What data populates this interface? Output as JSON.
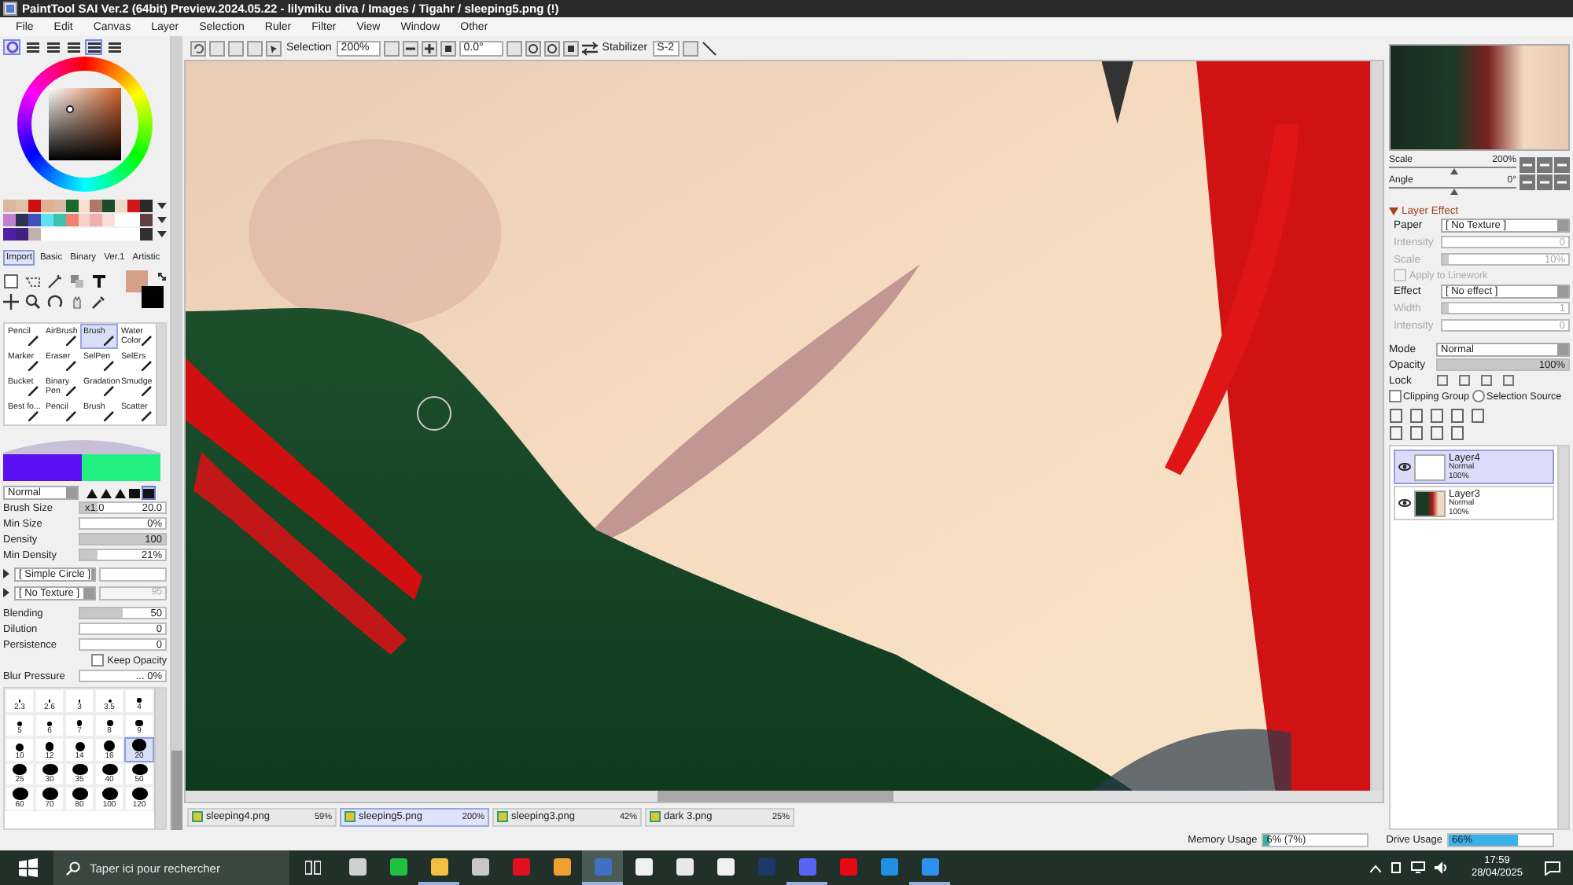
{
  "window": {
    "title": "PaintTool SAI Ver.2 (64bit) Preview.2024.05.22 - lilymiku diva / Images / Tigahr / sleeping5.png (!)"
  },
  "menu": [
    "File",
    "Edit",
    "Canvas",
    "Layer",
    "Selection",
    "Ruler",
    "Filter",
    "View",
    "Window",
    "Other"
  ],
  "panel_tabs": [
    {
      "selected": true
    },
    {
      "selected": false
    },
    {
      "selected": false
    },
    {
      "selected": false
    },
    {
      "selected": true
    },
    {
      "selected": false
    }
  ],
  "toolbar": {
    "selection_label": "Selection",
    "zoom": "200%",
    "angle": "0.0°",
    "stabilizer_label": "Stabilizer",
    "stabilizer": "S-2"
  },
  "swatches": [
    [
      {
        "color": "#d9b8a0"
      },
      {
        "color": "#e0c0a8"
      },
      {
        "color": "#cc1010"
      },
      {
        "color": "#e0b090"
      },
      {
        "color": "#d8b8a0"
      },
      {
        "color": "#1a6a30"
      },
      {
        "color": "#f5e0d0"
      },
      {
        "color": "#b07868"
      },
      {
        "color": "#1a4a28"
      },
      {
        "color": "#f0d8c8"
      },
      {
        "color": "#d01818"
      },
      {
        "color": "#2a2a2a"
      }
    ],
    [
      {
        "color": "#c080d0"
      },
      {
        "color": "#303050"
      },
      {
        "color": "#4050c0"
      },
      {
        "color": "#60e0f0"
      },
      {
        "color": "#40c0b0"
      },
      {
        "color": "#f08070"
      },
      {
        "color": "#f8d0c8"
      },
      {
        "color": "#f0b0b0"
      },
      {
        "color": "#f8e0d8"
      },
      {
        "color": "#ffffff"
      },
      {
        "color": "#ffffff"
      },
      {
        "color": "#604040"
      }
    ],
    [
      {
        "color": "#5020a0"
      },
      {
        "color": "#402080"
      },
      {
        "color": "#c0b0b0"
      },
      {
        "color": "#ffffff"
      },
      {
        "color": "#ffffff"
      },
      {
        "color": "#ffffff"
      },
      {
        "color": "#ffffff"
      },
      {
        "color": "#ffffff"
      },
      {
        "color": "#ffffff"
      },
      {
        "color": "#ffffff"
      },
      {
        "color": "#ffffff"
      },
      {
        "color": "#303030"
      }
    ]
  ],
  "tool_tabs": [
    {
      "label": "Import",
      "selected": true
    },
    {
      "label": "Basic",
      "selected": false
    },
    {
      "label": "Binary",
      "selected": false
    },
    {
      "label": "Ver.1",
      "selected": false
    },
    {
      "label": "Artistic",
      "selected": false
    }
  ],
  "brushes": [
    {
      "label": "Pencil",
      "selected": false
    },
    {
      "label": "AirBrush",
      "selected": false
    },
    {
      "label": "Brush",
      "selected": true
    },
    {
      "label": "Water Color",
      "selected": false
    },
    {
      "label": "Marker",
      "selected": false
    },
    {
      "label": "Eraser",
      "selected": false
    },
    {
      "label": "SelPen",
      "selected": false
    },
    {
      "label": "SelErs",
      "selected": false
    },
    {
      "label": "Bucket",
      "selected": false
    },
    {
      "label": "Binary Pen",
      "selected": false
    },
    {
      "label": "Gradation",
      "selected": false
    },
    {
      "label": "Smudge",
      "selected": false
    },
    {
      "label": "Best fo...",
      "selected": false
    },
    {
      "label": "Pencil",
      "selected": false
    },
    {
      "label": "Brush",
      "selected": false
    },
    {
      "label": "Scatter",
      "selected": false
    }
  ],
  "blend_mode": "Normal",
  "brush_settings": [
    {
      "label": "Brush Size",
      "prefix": "x1.0",
      "value": "20.0",
      "level": 0.2
    },
    {
      "label": "Min Size",
      "value": "0%",
      "level": 0
    },
    {
      "label": "Density",
      "value": "100",
      "level": 1
    },
    {
      "label": "Min Density",
      "value": "21%",
      "level": 0.21
    }
  ],
  "shape": "[ Simple Circle ]",
  "texture": "[ No Texture ]",
  "texture_strength": "95",
  "mix_settings": [
    {
      "label": "Blending",
      "value": "50",
      "level": 0.5
    },
    {
      "label": "Dilution",
      "value": "0",
      "level": 0
    },
    {
      "label": "Persistence",
      "value": "0",
      "level": 0
    }
  ],
  "keep_opacity": {
    "label": "Keep Opacity",
    "checked": false
  },
  "blur_pressure": {
    "label": "Blur Pressure",
    "value": "... 0%"
  },
  "brush_sizes": [
    {
      "label": "2.3",
      "selected": false
    },
    {
      "label": "2.6",
      "selected": false
    },
    {
      "label": "3",
      "selected": false
    },
    {
      "label": "3.5",
      "selected": false
    },
    {
      "label": "4",
      "selected": false
    },
    {
      "label": "5",
      "selected": false
    },
    {
      "label": "6",
      "selected": false
    },
    {
      "label": "7",
      "selected": false
    },
    {
      "label": "8",
      "selected": false
    },
    {
      "label": "9",
      "selected": false
    },
    {
      "label": "10",
      "selected": false
    },
    {
      "label": "12",
      "selected": false
    },
    {
      "label": "14",
      "selected": false
    },
    {
      "label": "16",
      "selected": false
    },
    {
      "label": "20",
      "selected": true
    },
    {
      "label": "25",
      "selected": false
    },
    {
      "label": "30",
      "selected": false
    },
    {
      "label": "35",
      "selected": false
    },
    {
      "label": "40",
      "selected": false
    },
    {
      "label": "50",
      "selected": false
    },
    {
      "label": "60",
      "selected": false
    },
    {
      "label": "70",
      "selected": false
    },
    {
      "label": "80",
      "selected": false
    },
    {
      "label": "100",
      "selected": false
    },
    {
      "label": "120",
      "selected": false
    }
  ],
  "navigator": {
    "scale": {
      "label": "Scale",
      "value": "200%",
      "level": 0.5
    },
    "angle": {
      "label": "Angle",
      "value": "0°",
      "level": 0.5
    }
  },
  "layer_effect": {
    "title": "Layer Effect",
    "expanded": true,
    "rows": [
      {
        "kind": "dropdown",
        "label": "Paper",
        "value": "[ No Texture ]"
      },
      {
        "kind": "slider",
        "label": "Intensity",
        "value": "0",
        "level": 0,
        "disabled": true
      },
      {
        "kind": "slider",
        "label": "Scale",
        "value": "10%",
        "level": 0.05,
        "disabled": true
      },
      {
        "kind": "checkbox",
        "label": "Apply to Linework",
        "checked": false,
        "disabled": true
      },
      {
        "kind": "dropdown",
        "label": "Effect",
        "value": "[ No effect ]"
      },
      {
        "kind": "slider",
        "label": "Width",
        "value": "1",
        "level": 0.05,
        "disabled": true
      },
      {
        "kind": "slider",
        "label": "Intensity",
        "value": "0",
        "level": 0,
        "disabled": true
      }
    ]
  },
  "mode": {
    "label": "Mode",
    "value": "Normal"
  },
  "opacity": {
    "label": "Opacity",
    "value": "100%",
    "level": 1
  },
  "lock_label": "Lock",
  "clipping_group": {
    "label": "Clipping Group",
    "checked": false
  },
  "selection_source": {
    "label": "Selection Source",
    "checked": false
  },
  "layers": [
    {
      "name": "Layer4",
      "mode": "Normal",
      "opacity": "100%",
      "selected": true,
      "visible": true,
      "kind": "blank"
    },
    {
      "name": "Layer3",
      "mode": "Normal",
      "opacity": "100%",
      "selected": false,
      "visible": true,
      "kind": "painting"
    }
  ],
  "documents": [
    {
      "name": "sleeping4.png",
      "zoom": "59%",
      "selected": false
    },
    {
      "name": "sleeping5.png",
      "zoom": "200%",
      "selected": true
    },
    {
      "name": "sleeping3.png",
      "zoom": "42%",
      "selected": false
    },
    {
      "name": "dark 3.png",
      "zoom": "25%",
      "selected": false
    }
  ],
  "status_bar": {
    "memory": {
      "label": "Memory Usage",
      "value": "6% (7%)",
      "level": 0.06
    },
    "drive": {
      "label": "Drive Usage",
      "value": "66%",
      "level": 0.66
    }
  },
  "taskbar": {
    "search_placeholder": "Taper ici pour rechercher",
    "apps": [
      {
        "color": "#d0d0d0",
        "running": false,
        "selected": false
      },
      {
        "color": "#20c040",
        "running": false,
        "selected": false
      },
      {
        "color": "#f0c040",
        "running": true,
        "selected": false
      },
      {
        "color": "#c8c8c8",
        "running": false,
        "selected": false
      },
      {
        "color": "#e01020",
        "running": false,
        "selected": false
      },
      {
        "color": "#f0a030",
        "running": false,
        "selected": false
      },
      {
        "color": "#4070c0",
        "running": true,
        "selected": true
      },
      {
        "color": "#f0f0f0",
        "running": false,
        "selected": false
      },
      {
        "color": "#e8e8e8",
        "running": false,
        "selected": false
      },
      {
        "color": "#f0f0f0",
        "running": false,
        "selected": false
      },
      {
        "color": "#1b3a6a",
        "running": false,
        "selected": false
      },
      {
        "color": "#5865f2",
        "running": true,
        "selected": false
      },
      {
        "color": "#e50914",
        "running": false,
        "selected": false
      },
      {
        "color": "#2090e0",
        "running": false,
        "selected": false
      },
      {
        "color": "#3090f0",
        "running": true,
        "selected": false
      }
    ],
    "time": "17:59",
    "date": "28/04/2025"
  }
}
